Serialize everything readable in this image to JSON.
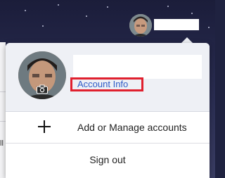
{
  "account_menu": {
    "account_info_link": "Account Info",
    "add_manage_label": "Add or Manage accounts",
    "sign_out_label": "Sign out"
  },
  "icons": {
    "add": "plus-icon",
    "camera": "camera-icon"
  },
  "colors": {
    "highlight_border": "#e0202e",
    "link": "#2f5cc7",
    "menu_header_bg": "#eef0f5"
  }
}
